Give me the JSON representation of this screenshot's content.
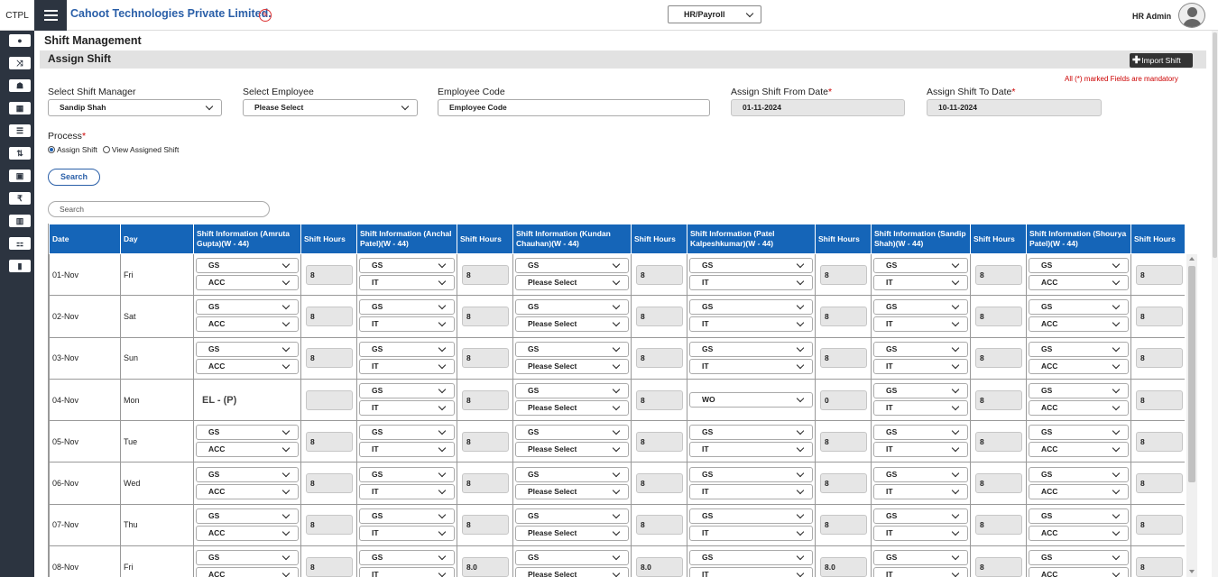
{
  "header": {
    "brand": "CTPL",
    "company": "Cahoot Technologies Private Limited.",
    "module": "HR/Payroll",
    "user": "HR Admin"
  },
  "sidebar": {
    "icons": [
      "dashboard-icon",
      "shuffle-icon",
      "team-icon",
      "calendar-icon",
      "list-icon",
      "sort-icon",
      "cash-icon",
      "rupee-icon",
      "chart-icon",
      "org-icon",
      "bookmark-icon"
    ]
  },
  "page": {
    "title": "Shift Management",
    "section": "Assign Shift",
    "import_label": "Import Shift",
    "mandatory_note": "All (*) marked Fields are mandatory"
  },
  "form": {
    "shift_manager": {
      "label": "Select Shift Manager",
      "value": "Sandip Shah"
    },
    "employee": {
      "label": "Select Employee",
      "value": "Please Select"
    },
    "employee_code": {
      "label": "Employee Code",
      "placeholder": "Employee Code"
    },
    "from_date": {
      "label": "Assign Shift From Date",
      "value": "01-11-2024"
    },
    "to_date": {
      "label": "Assign Shift To Date",
      "value": "10-11-2024"
    },
    "process": {
      "label": "Process",
      "option1": "Assign Shift",
      "option2": "View Assigned Shift"
    },
    "search_label": "Search",
    "req": "*"
  },
  "grid": {
    "search_placeholder": "Search",
    "columns": [
      "Date",
      "Day",
      "Shift Information (Amruta Gupta)(W - 44)",
      "Shift Hours",
      "Shift Information (Anchal Patel)(W - 44)",
      "Shift Hours",
      "Shift Information (Kundan Chauhan)(W - 44)",
      "Shift Hours",
      "Shift Information (Patel Kalpeshkumar)(W - 44)",
      "Shift Hours",
      "Shift Information (Sandip Shah)(W - 44)",
      "Shift Hours",
      "Shift Information (Shourya Patel)(W - 44)",
      "Shift Hours"
    ],
    "rows": [
      {
        "date": "01-Nov",
        "day": "Fri",
        "cells": [
          {
            "shift": "GS",
            "dept": "ACC",
            "hours": "8"
          },
          {
            "shift": "GS",
            "dept": "IT",
            "hours": "8"
          },
          {
            "shift": "GS",
            "dept": "Please Select",
            "hours": "8"
          },
          {
            "shift": "GS",
            "dept": "IT",
            "hours": "8"
          },
          {
            "shift": "GS",
            "dept": "IT",
            "hours": "8"
          },
          {
            "shift": "GS",
            "dept": "ACC",
            "hours": "8"
          }
        ]
      },
      {
        "date": "02-Nov",
        "day": "Sat",
        "cells": [
          {
            "shift": "GS",
            "dept": "ACC",
            "hours": "8"
          },
          {
            "shift": "GS",
            "dept": "IT",
            "hours": "8"
          },
          {
            "shift": "GS",
            "dept": "Please Select",
            "hours": "8"
          },
          {
            "shift": "GS",
            "dept": "IT",
            "hours": "8"
          },
          {
            "shift": "GS",
            "dept": "IT",
            "hours": "8"
          },
          {
            "shift": "GS",
            "dept": "ACC",
            "hours": "8"
          }
        ]
      },
      {
        "date": "03-Nov",
        "day": "Sun",
        "cells": [
          {
            "shift": "GS",
            "dept": "ACC",
            "hours": "8"
          },
          {
            "shift": "GS",
            "dept": "IT",
            "hours": "8"
          },
          {
            "shift": "GS",
            "dept": "Please Select",
            "hours": "8"
          },
          {
            "shift": "GS",
            "dept": "IT",
            "hours": "8"
          },
          {
            "shift": "GS",
            "dept": "IT",
            "hours": "8"
          },
          {
            "shift": "GS",
            "dept": "ACC",
            "hours": "8"
          }
        ]
      },
      {
        "date": "04-Nov",
        "day": "Mon",
        "cells": [
          {
            "leave": "EL - (P)",
            "hours": ""
          },
          {
            "shift": "GS",
            "dept": "IT",
            "hours": "8"
          },
          {
            "shift": "GS",
            "dept": "Please Select",
            "hours": "8"
          },
          {
            "single": "WO",
            "hours": "0"
          },
          {
            "shift": "GS",
            "dept": "IT",
            "hours": "8"
          },
          {
            "shift": "GS",
            "dept": "ACC",
            "hours": "8"
          }
        ]
      },
      {
        "date": "05-Nov",
        "day": "Tue",
        "cells": [
          {
            "shift": "GS",
            "dept": "ACC",
            "hours": "8"
          },
          {
            "shift": "GS",
            "dept": "IT",
            "hours": "8"
          },
          {
            "shift": "GS",
            "dept": "Please Select",
            "hours": "8"
          },
          {
            "shift": "GS",
            "dept": "IT",
            "hours": "8"
          },
          {
            "shift": "GS",
            "dept": "IT",
            "hours": "8"
          },
          {
            "shift": "GS",
            "dept": "ACC",
            "hours": "8"
          }
        ]
      },
      {
        "date": "06-Nov",
        "day": "Wed",
        "cells": [
          {
            "shift": "GS",
            "dept": "ACC",
            "hours": "8"
          },
          {
            "shift": "GS",
            "dept": "IT",
            "hours": "8"
          },
          {
            "shift": "GS",
            "dept": "Please Select",
            "hours": "8"
          },
          {
            "shift": "GS",
            "dept": "IT",
            "hours": "8"
          },
          {
            "shift": "GS",
            "dept": "IT",
            "hours": "8"
          },
          {
            "shift": "GS",
            "dept": "ACC",
            "hours": "8"
          }
        ]
      },
      {
        "date": "07-Nov",
        "day": "Thu",
        "cells": [
          {
            "shift": "GS",
            "dept": "ACC",
            "hours": "8"
          },
          {
            "shift": "GS",
            "dept": "IT",
            "hours": "8"
          },
          {
            "shift": "GS",
            "dept": "Please Select",
            "hours": "8"
          },
          {
            "shift": "GS",
            "dept": "IT",
            "hours": "8"
          },
          {
            "shift": "GS",
            "dept": "IT",
            "hours": "8"
          },
          {
            "shift": "GS",
            "dept": "ACC",
            "hours": "8"
          }
        ]
      },
      {
        "date": "08-Nov",
        "day": "Fri",
        "cells": [
          {
            "shift": "GS",
            "dept": "ACC",
            "hours": "8"
          },
          {
            "shift": "GS",
            "dept": "IT",
            "hours": "8.0"
          },
          {
            "shift": "GS",
            "dept": "Please Select",
            "hours": "8.0"
          },
          {
            "shift": "GS",
            "dept": "IT",
            "hours": "8.0"
          },
          {
            "shift": "GS",
            "dept": "IT",
            "hours": "8"
          },
          {
            "shift": "GS",
            "dept": "ACC",
            "hours": "8"
          }
        ]
      }
    ]
  }
}
